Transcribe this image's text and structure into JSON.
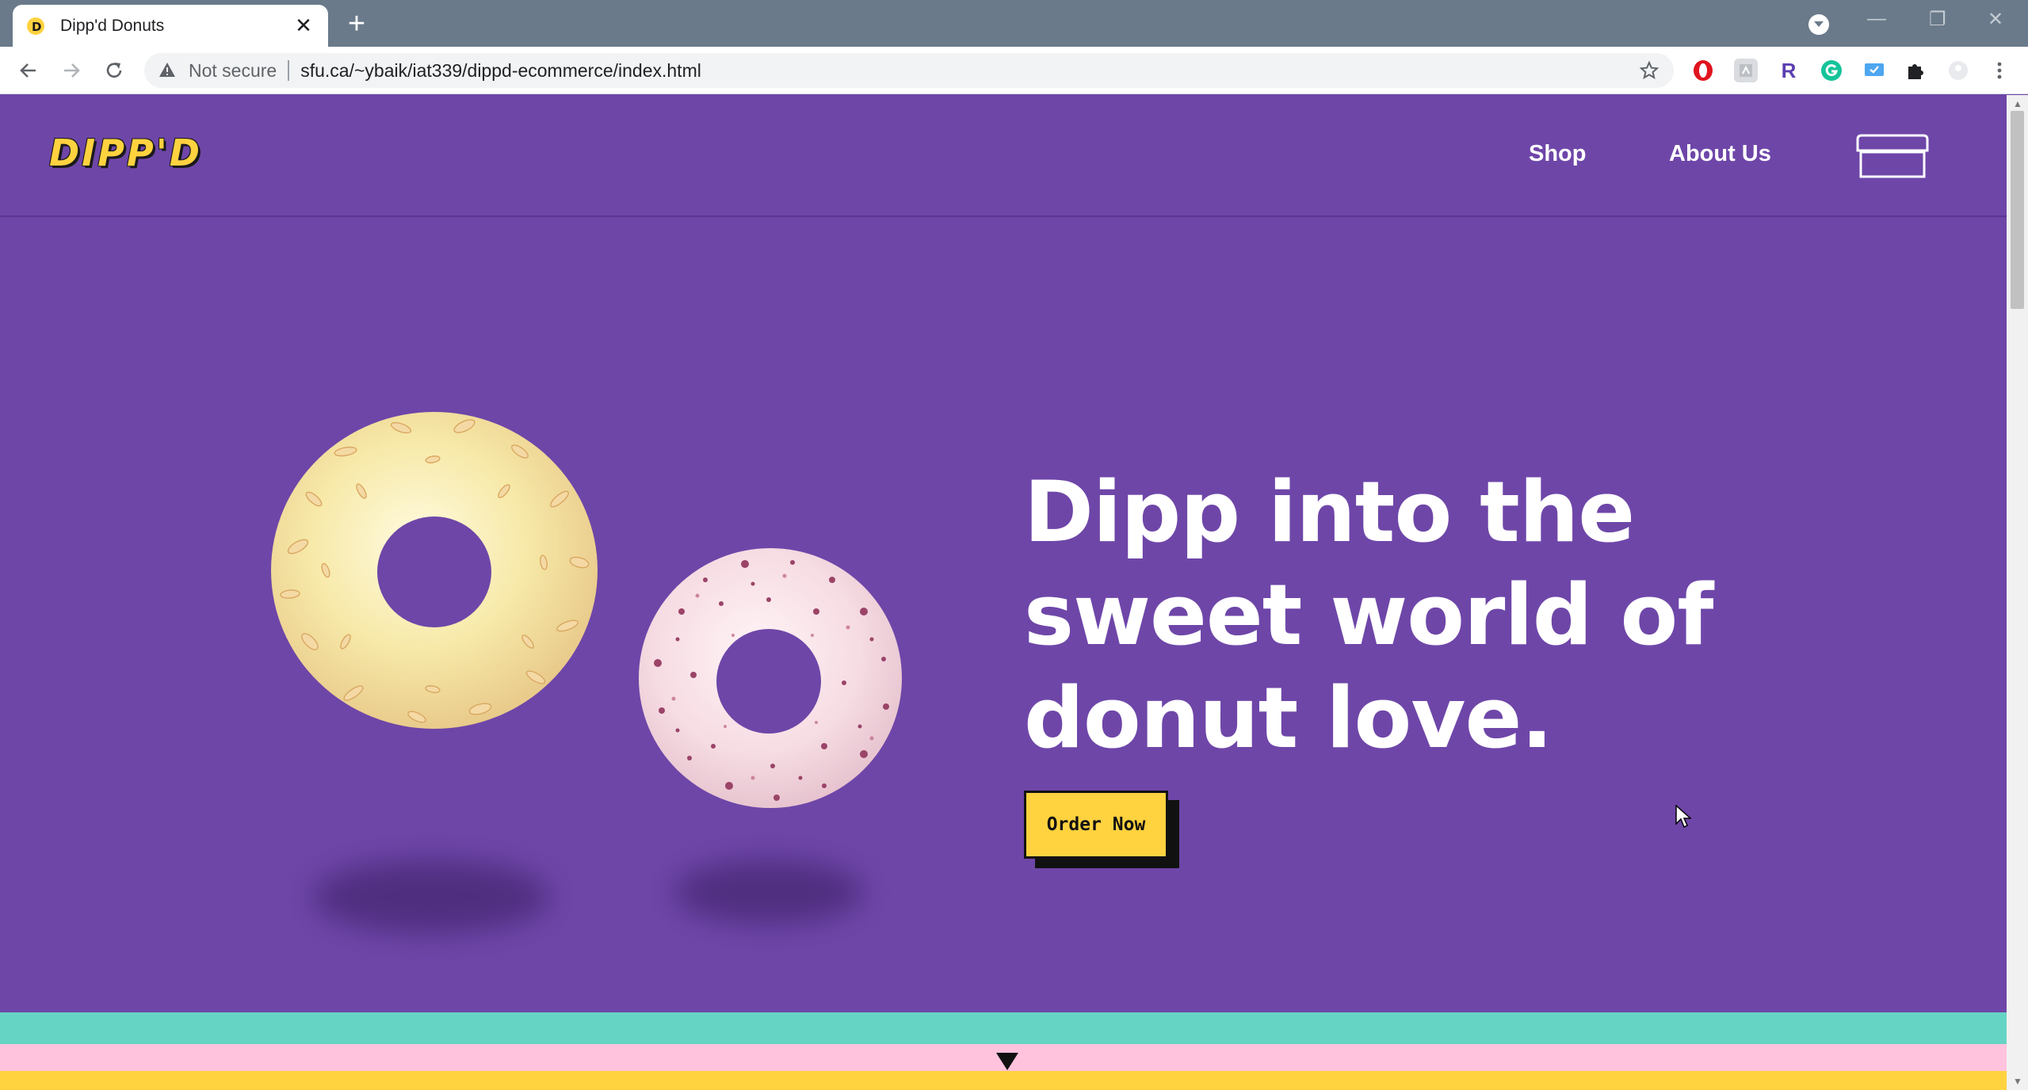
{
  "browser": {
    "tab_title": "Dipp'd Donuts",
    "security_label": "Not secure",
    "url": "sfu.ca/~ybaik/iat339/dippd-ecommerce/index.html",
    "extensions": [
      {
        "name": "opera-icon",
        "color": "#e0141e"
      },
      {
        "name": "reader-icon",
        "color": "#9aa0a6"
      },
      {
        "name": "r-extension-icon",
        "color": "#5b3fb0",
        "glyph": "R"
      },
      {
        "name": "grammarly-icon",
        "color": "#15c39a"
      },
      {
        "name": "screencast-icon",
        "color": "#4ea6f0"
      },
      {
        "name": "puzzle-icon",
        "color": "#202124"
      }
    ]
  },
  "site": {
    "logo": "DIPP'D",
    "nav": {
      "shop": "Shop",
      "about": "About Us"
    },
    "hero": {
      "title": "Dipp into the sweet world of donut love.",
      "cta": "Order Now"
    }
  },
  "colors": {
    "background": "#6e46a8",
    "brand_yellow": "#ffd23f",
    "stripe_teal": "#66d4c4",
    "stripe_pink": "#ffc3de",
    "stripe_yellow": "#ffd23f"
  }
}
